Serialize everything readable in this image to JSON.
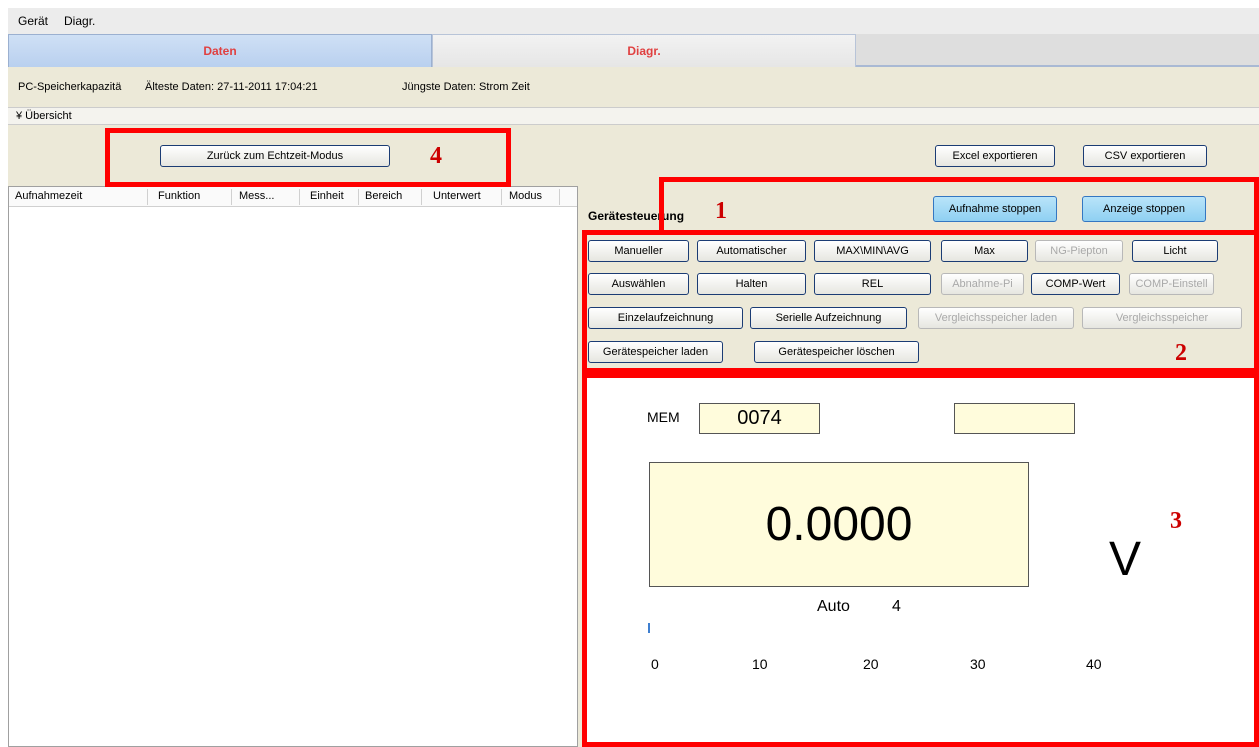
{
  "menu": {
    "items": [
      "Gerät",
      "Diagr."
    ]
  },
  "tabs": {
    "daten": "Daten",
    "diagr": "Diagr."
  },
  "info": {
    "capacity": "PC-Speicherkapazitä",
    "oldest": "Älteste Daten: 27-11-2011 17:04:21",
    "newest": "Jüngste Daten:  Strom Zeit"
  },
  "overview": {
    "label": "¥ Übersicht"
  },
  "buttons": {
    "back_realtime": "Zurück zum Echtzeit-Modus",
    "excel": "Excel exportieren",
    "csv": "CSV exportieren",
    "stop_recording": "Aufnahme stoppen",
    "stop_display": "Anzeige stoppen"
  },
  "table": {
    "columns": [
      "Aufnahmezeit",
      "Funktion",
      "Mess...",
      "Einheit",
      "Bereich",
      "Unterwert",
      "Modus"
    ]
  },
  "device_control": {
    "label": "Gerätesteuerung",
    "row1": [
      "Manueller",
      "Automatischer",
      "MAX\\MIN\\AVG",
      "Max",
      "NG-Piepton",
      "Licht"
    ],
    "row2": [
      "Auswählen",
      "Halten",
      "REL",
      "Abnahme-Pi",
      "COMP-Wert",
      "COMP-Einstell"
    ],
    "row3": [
      "Einzelaufzeichnung",
      "Serielle Aufzeichnung",
      "Vergleichsspeicher laden",
      "Vergleichsspeicher"
    ],
    "row4": [
      "Gerätespeicher laden",
      "Gerätespeicher löschen"
    ],
    "disabled": [
      "NG-Piepton",
      "Abnahme-Pi",
      "COMP-Einstell",
      "Vergleichsspeicher laden",
      "Vergleichsspeicher"
    ]
  },
  "display": {
    "mem_label": "MEM",
    "mem_value": "0074",
    "aux_value": "",
    "reading": "0.0000",
    "unit": "V",
    "mode": "Auto",
    "range": "4",
    "scale": [
      "0",
      "10",
      "20",
      "30",
      "40"
    ],
    "bar_value": 0
  },
  "annotations": {
    "n1": "1",
    "n2": "2",
    "n3": "3",
    "n4": "4"
  },
  "colors": {
    "annotation_red": "#ff0000",
    "tab_text": "#e04040",
    "lcd_bg": "#fffcdc",
    "blue_button": "#8fd0f2"
  }
}
